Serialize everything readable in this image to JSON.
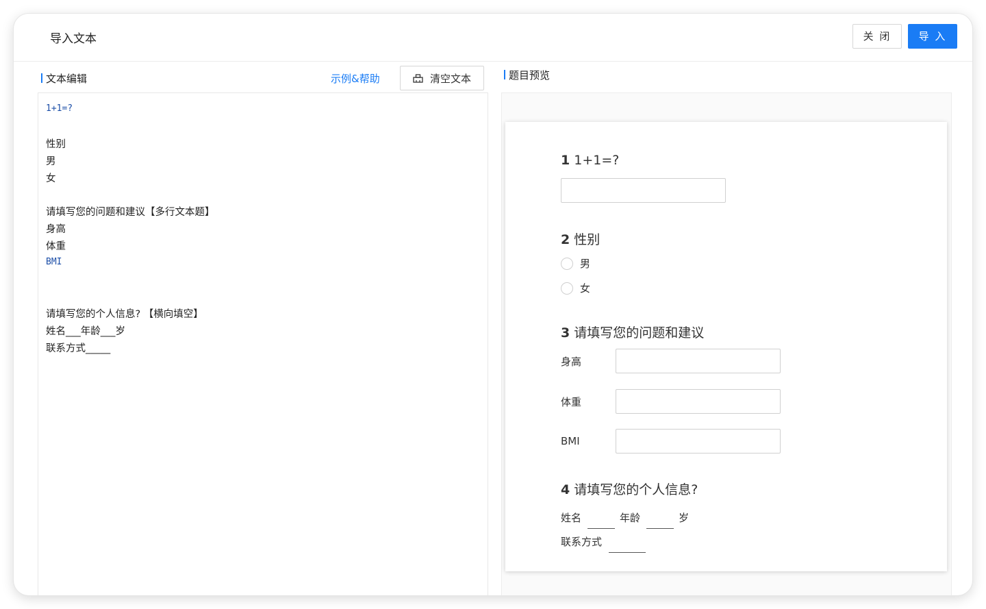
{
  "header": {
    "title": "导入文本",
    "close_label": "关 闭",
    "import_label": "导 入"
  },
  "editor": {
    "section_label": "文本编辑",
    "help_label": "示例&帮助",
    "clear_label": "清空文本",
    "lines": [
      "1+1=?",
      "性别",
      "男",
      "女",
      "请填写您的问题和建议【多行文本题】",
      "身高",
      "体重",
      "BMI",
      "请填写您的个人信息? 【横向填空】",
      "姓名___年龄___岁",
      "联系方式_____"
    ]
  },
  "preview": {
    "section_label": "题目预览",
    "q1": {
      "num": "1",
      "title": "1+1=?"
    },
    "q2": {
      "num": "2",
      "title": "性别",
      "options": [
        "男",
        "女"
      ]
    },
    "q3": {
      "num": "3",
      "title": "请填写您的问题和建议",
      "fields": [
        "身高",
        "体重",
        "BMI"
      ]
    },
    "q4": {
      "num": "4",
      "title": "请填写您的个人信息?",
      "name_label": "姓名",
      "age_label": "年龄",
      "age_unit": "岁",
      "contact_label": "联系方式"
    }
  },
  "colors": {
    "accent": "#1a7cf5",
    "code_text": "#1d4fa8"
  },
  "icons": {
    "clear": "eraser-icon"
  }
}
